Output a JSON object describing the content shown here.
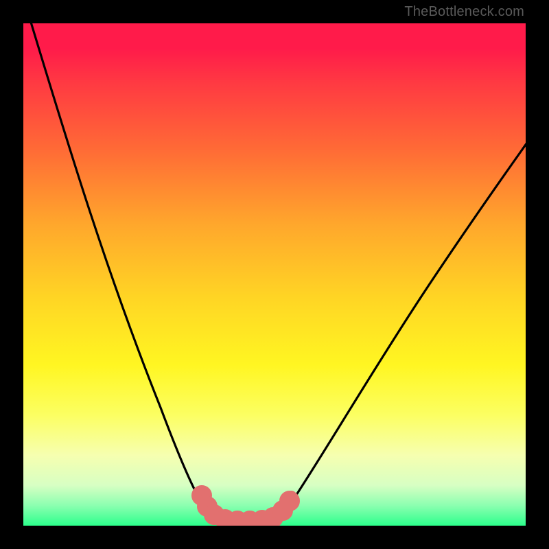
{
  "watermark": {
    "text": "TheBottleneck.com"
  },
  "chart_data": {
    "type": "line",
    "title": "",
    "xlabel": "",
    "ylabel": "",
    "xlim": [
      0,
      100
    ],
    "ylim": [
      0,
      100
    ],
    "grid": false,
    "legend": false,
    "background": {
      "type": "vertical-gradient",
      "stops": [
        {
          "pos": 0,
          "color": "#ff1b4a"
        },
        {
          "pos": 25,
          "color": "#ff6a36"
        },
        {
          "pos": 55,
          "color": "#ffd624"
        },
        {
          "pos": 78,
          "color": "#fcff62"
        },
        {
          "pos": 100,
          "color": "#2cff8c"
        }
      ]
    },
    "series": [
      {
        "name": "bottleneck-curve",
        "color": "#000000",
        "x": [
          0,
          4,
          8,
          12,
          16,
          20,
          24,
          28,
          32,
          34,
          36,
          38,
          40,
          42,
          44,
          46,
          48,
          52,
          56,
          62,
          68,
          74,
          80,
          86,
          92,
          98,
          100
        ],
        "y": [
          100,
          90,
          80,
          70,
          60,
          50,
          40,
          30,
          20,
          14,
          9,
          5,
          2,
          1,
          1,
          1,
          1,
          2,
          5,
          12,
          20,
          28,
          36,
          44,
          52,
          59,
          61
        ]
      },
      {
        "name": "optimal-band",
        "color": "#e2706f",
        "type": "marker-band",
        "x": [
          35,
          36.5,
          38,
          40,
          42,
          44,
          46,
          48,
          49.5,
          51
        ],
        "y": [
          5,
          3,
          1.5,
          1,
          1,
          1,
          1,
          1.5,
          3,
          5
        ]
      }
    ]
  }
}
